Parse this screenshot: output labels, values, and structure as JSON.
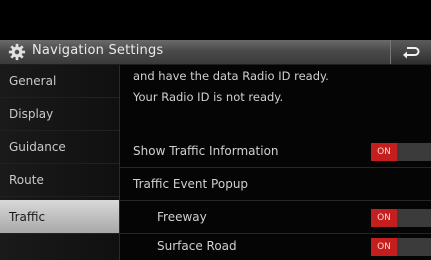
{
  "header": {
    "title": "Navigation Settings",
    "gear_icon": "gear-icon",
    "back_icon": "back-arrow-icon"
  },
  "sidebar": {
    "items": [
      {
        "label": "General",
        "active": false
      },
      {
        "label": "Display",
        "active": false
      },
      {
        "label": "Guidance",
        "active": false
      },
      {
        "label": "Route",
        "active": false
      },
      {
        "label": "Traffic",
        "active": true
      }
    ]
  },
  "content": {
    "info_line1": "and have the data Radio ID ready.",
    "info_line2": "Your Radio ID is not ready.",
    "rows": [
      {
        "label": "Show Traffic Information",
        "toggle": "ON"
      },
      {
        "label": "Traffic Event Popup"
      },
      {
        "label": "Freeway",
        "toggle": "ON"
      },
      {
        "label": "Surface Road",
        "toggle": "ON"
      }
    ]
  },
  "colors": {
    "toggle_on": "#c41e1e",
    "active_tab": "#c8c8c8"
  }
}
